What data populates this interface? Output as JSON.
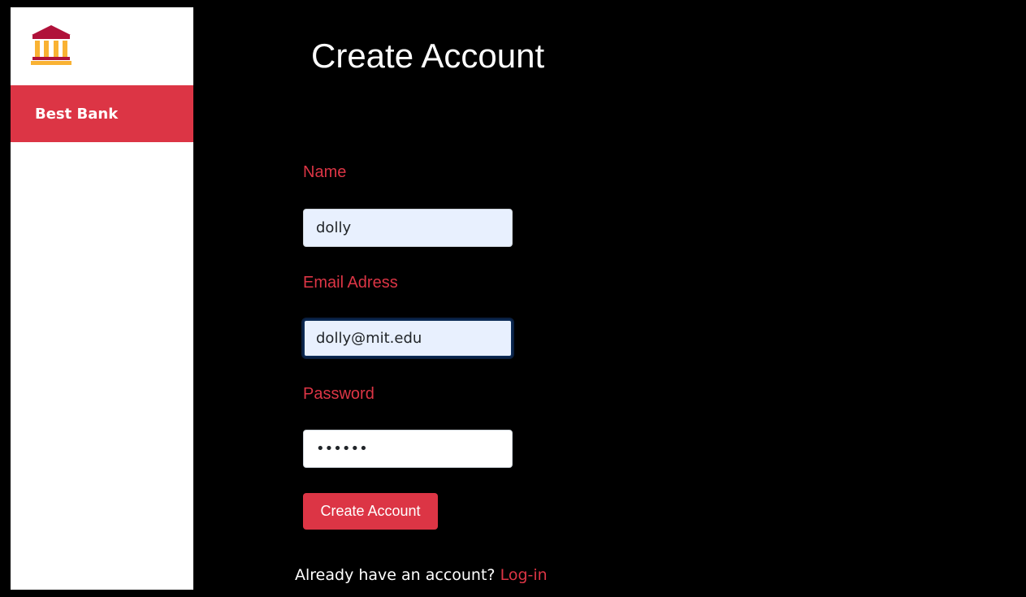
{
  "sidebar": {
    "logo_icon": "bank-icon",
    "nav_item_label": "Best Bank"
  },
  "form": {
    "title": "Create Account",
    "name_label": "Name",
    "name_value": "dolly",
    "email_label": "Email Adress",
    "email_value": "dolly@mit.edu",
    "password_label": "Password",
    "password_value": "••••••",
    "submit_label": "Create Account",
    "footer_text": "Already have an account?",
    "login_link": "Log-in"
  },
  "colors": {
    "accent": "#dc3545",
    "autofill_bg": "#e8f0fe",
    "background": "#000000",
    "sidebar_bg": "#ffffff"
  }
}
